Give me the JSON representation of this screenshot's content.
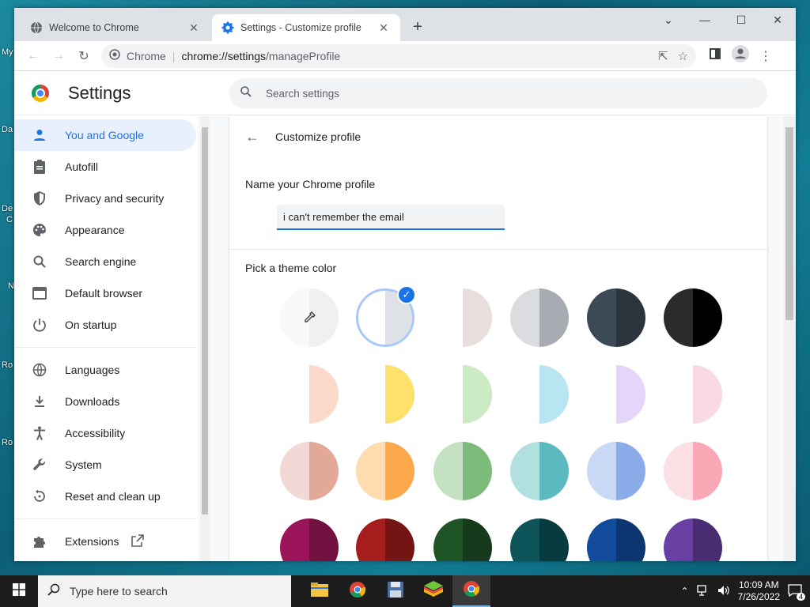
{
  "desktop": {
    "labels": [
      "My",
      "Da",
      "De",
      "C",
      "N",
      "Ro",
      "Ro"
    ]
  },
  "tabs": [
    {
      "title": "Welcome to Chrome",
      "active": false,
      "close": "✕"
    },
    {
      "title": "Settings - Customize profile",
      "active": true,
      "close": "✕"
    }
  ],
  "new_tab": "+",
  "window_controls": {
    "minimize": "—",
    "maximize": "☐",
    "close": "✕",
    "tab_search": "⌄"
  },
  "omnibox": {
    "site": "Chrome",
    "url_host": "chrome://settings",
    "url_path": "/manageProfile"
  },
  "settings": {
    "title": "Settings",
    "search_placeholder": "Search settings",
    "nav_items": [
      {
        "label": "You and Google",
        "icon": "person-icon",
        "active": true
      },
      {
        "label": "Autofill",
        "icon": "clipboard-icon"
      },
      {
        "label": "Privacy and security",
        "icon": "shield-icon"
      },
      {
        "label": "Appearance",
        "icon": "palette-icon"
      },
      {
        "label": "Search engine",
        "icon": "search-icon"
      },
      {
        "label": "Default browser",
        "icon": "browser-icon"
      },
      {
        "label": "On startup",
        "icon": "power-icon"
      },
      {
        "label": "Languages",
        "icon": "globe-icon"
      },
      {
        "label": "Downloads",
        "icon": "download-icon"
      },
      {
        "label": "Accessibility",
        "icon": "accessibility-icon"
      },
      {
        "label": "System",
        "icon": "wrench-icon"
      },
      {
        "label": "Reset and clean up",
        "icon": "reset-icon"
      },
      {
        "label": "Extensions",
        "icon": "puzzle-icon"
      }
    ]
  },
  "customize": {
    "heading": "Customize profile",
    "name_label": "Name your Chrome profile",
    "name_value": "i can't remember the email",
    "theme_label": "Pick a theme color",
    "themes": [
      {
        "left": "#f8f9fa",
        "right": "#eef0f2",
        "picker": true
      },
      {
        "left": "#ffffff",
        "right": "#dee1e6",
        "selected": true
      },
      {
        "left": "#ffffff",
        "right": "#e8dedc"
      },
      {
        "left": "#dadce0",
        "right": "#a8abb2"
      },
      {
        "left": "#3c4a57",
        "right": "#2c353e"
      },
      {
        "left": "#2b2b2b",
        "right": "#000000"
      },
      {
        "left": "#ffffff",
        "right": "#fcdac9"
      },
      {
        "left": "#ffffff",
        "right": "#fde16b"
      },
      {
        "left": "#ffffff",
        "right": "#ccebc5"
      },
      {
        "left": "#ffffff",
        "right": "#b8e5f2"
      },
      {
        "left": "#ffffff",
        "right": "#e6d5fb"
      },
      {
        "left": "#ffffff",
        "right": "#f9d9e6"
      },
      {
        "left": "#f3d9d5",
        "right": "#e2a898"
      },
      {
        "left": "#fddcb0",
        "right": "#fca94d"
      },
      {
        "left": "#c4e1c2",
        "right": "#7dbb7a"
      },
      {
        "left": "#b2e0e1",
        "right": "#5bbac0"
      },
      {
        "left": "#cad9f5",
        "right": "#8aade9"
      },
      {
        "left": "#fcdfe4",
        "right": "#fba8b6"
      },
      {
        "left": "#9c1459",
        "right": "#701140"
      },
      {
        "left": "#a51d1d",
        "right": "#751414"
      },
      {
        "left": "#1f5427",
        "right": "#173a1d"
      },
      {
        "left": "#0c5459",
        "right": "#083b3f"
      },
      {
        "left": "#124b9c",
        "right": "#0d3570"
      },
      {
        "left": "#6a3fa3",
        "right": "#4a2c73"
      }
    ]
  },
  "taskbar": {
    "search_placeholder": "Type here to search",
    "time": "10:09 AM",
    "date": "7/26/2022",
    "notifications": "4"
  }
}
